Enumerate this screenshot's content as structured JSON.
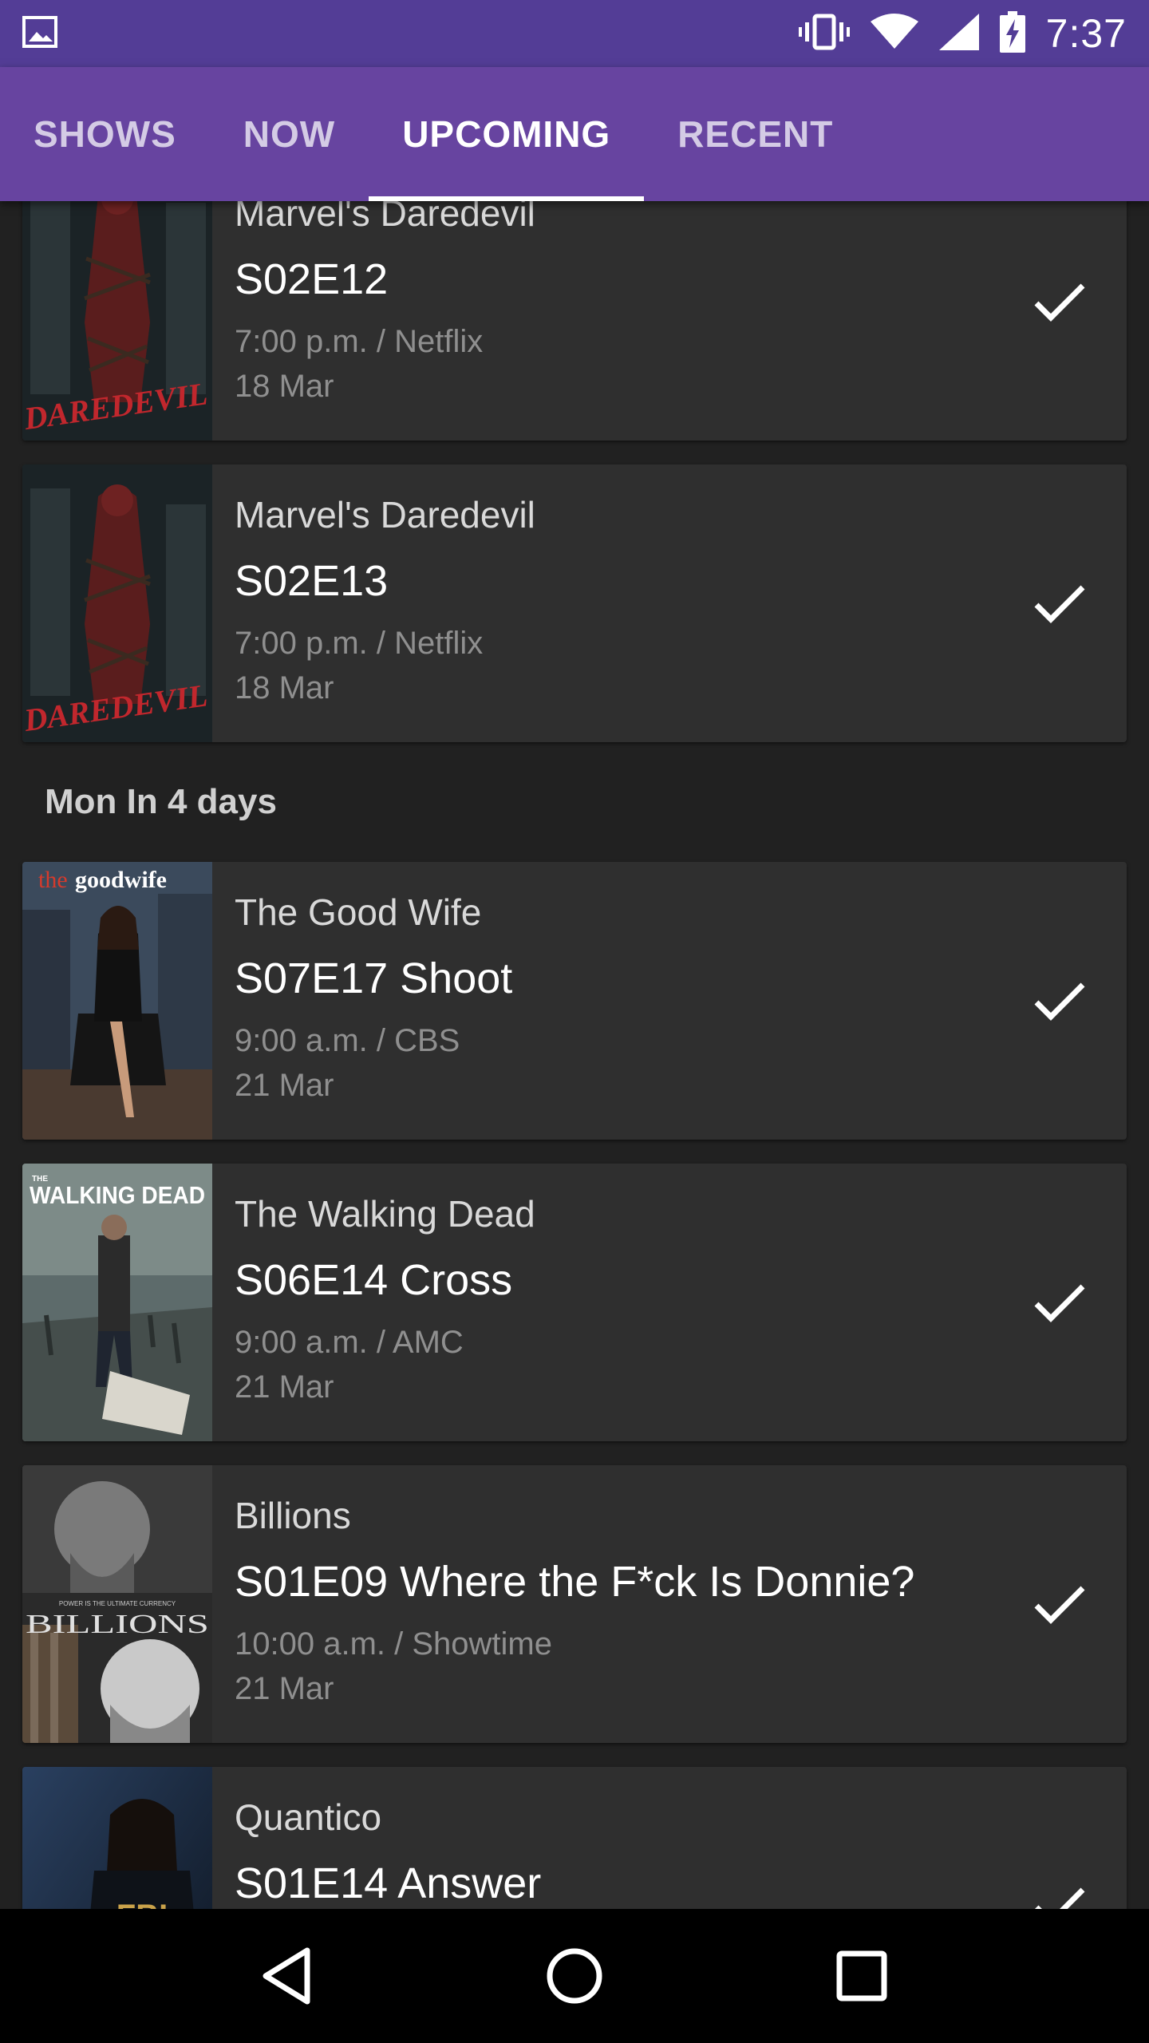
{
  "status_bar": {
    "time": "7:37",
    "icons": [
      "image-icon",
      "vibrate-icon",
      "wifi-icon",
      "signal-icon",
      "battery-charging-icon"
    ]
  },
  "tabs": [
    {
      "label": "SHOWS",
      "active": false
    },
    {
      "label": "NOW",
      "active": false
    },
    {
      "label": "UPCOMING",
      "active": true
    },
    {
      "label": "RECENT",
      "active": false
    }
  ],
  "colors": {
    "status_bar": "#533d96",
    "tab_bar": "#6744a0",
    "background": "#212121",
    "card": "#2f2f2f"
  },
  "episodes_before": [
    {
      "show": "Marvel's Daredevil",
      "episode": "S02E12",
      "time_network": "7:00 p.m. / Netflix",
      "date": "18 Mar",
      "poster": "daredevil",
      "watched_icon": "check-icon"
    },
    {
      "show": "Marvel's Daredevil",
      "episode": "S02E13",
      "time_network": "7:00 p.m. / Netflix",
      "date": "18 Mar",
      "poster": "daredevil",
      "watched_icon": "check-icon"
    }
  ],
  "section": {
    "title": "Mon In 4 days"
  },
  "episodes_after": [
    {
      "show": "The Good Wife",
      "episode": "S07E17 Shoot",
      "time_network": "9:00 a.m. / CBS",
      "date": "21 Mar",
      "poster": "goodwife",
      "watched_icon": "check-icon"
    },
    {
      "show": "The Walking Dead",
      "episode": "S06E14 Cross",
      "time_network": "9:00 a.m. / AMC",
      "date": "21 Mar",
      "poster": "walkingdead",
      "watched_icon": "check-icon"
    },
    {
      "show": "Billions",
      "episode": "S01E09 Where the F*ck Is Donnie?",
      "time_network": "10:00 a.m. / Showtime",
      "date": "21 Mar",
      "poster": "billions",
      "watched_icon": "check-icon"
    },
    {
      "show": "Quantico",
      "episode": "S01E14 Answer",
      "time_network": "",
      "date": "",
      "poster": "quantico",
      "watched_icon": "check-icon"
    }
  ],
  "posters": {
    "daredevil": {
      "title": "DAREDEVIL",
      "bg": "#1b2326",
      "accent": "#c1272d"
    },
    "goodwife": {
      "title_prefix": "the",
      "title_main": "goodwife",
      "bg": "#4a3a30",
      "accent": "#d63a2c"
    },
    "walkingdead": {
      "title": "WALKING DEAD",
      "subtitle": "THE",
      "bg": "#4d5a5a",
      "accent": "#ffffff"
    },
    "billions": {
      "title": "BILLIONS",
      "tagline": "POWER IS THE ULTIMATE CURRENCY",
      "bg": "#2a2a2a",
      "accent": "#e0e0e0"
    },
    "quantico": {
      "title": "",
      "bg": "#1c2a3a",
      "accent": "#3a5a8a"
    }
  },
  "nav": [
    {
      "name": "back-button",
      "icon": "back-triangle-icon"
    },
    {
      "name": "home-button",
      "icon": "home-circle-icon"
    },
    {
      "name": "recents-button",
      "icon": "recents-square-icon"
    }
  ]
}
